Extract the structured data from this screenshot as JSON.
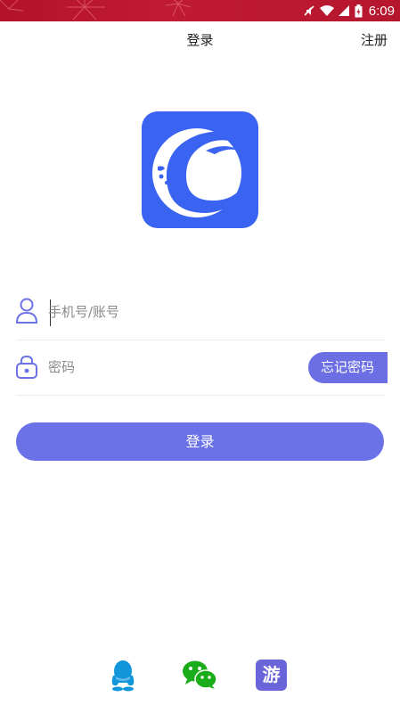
{
  "status_bar": {
    "time": "6:09"
  },
  "header": {
    "title": "登录",
    "register_label": "注册"
  },
  "form": {
    "phone_placeholder": "手机号/账号",
    "password_placeholder": "密码",
    "forgot_label": "忘记密码"
  },
  "login_button": {
    "label": "登录"
  },
  "social": {
    "guest_label": "游"
  },
  "colors": {
    "accent": "#6b72e8",
    "status_bar": "#b3122a",
    "logo_bg": "#3a63f2",
    "wechat": "#1aad19",
    "qq": "#1296db"
  }
}
